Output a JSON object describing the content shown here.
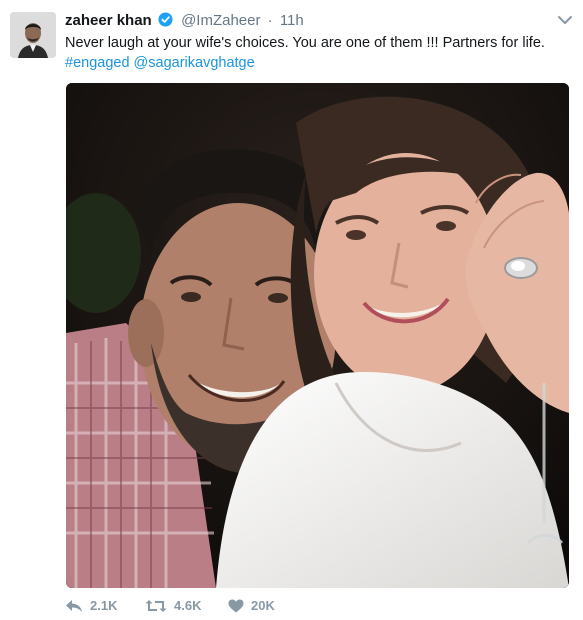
{
  "tweet": {
    "name": "zaheer khan",
    "handle": "@ImZaheer",
    "separator": "·",
    "time": "11h",
    "text": "Never laugh at your wife's choices. You are one of them !!!  Partners for life.",
    "hashtag": "#engaged",
    "mention": "@sagarikavghatge"
  },
  "actions": {
    "replies": "2.1K",
    "retweets": "4.6K",
    "likes": "20K"
  },
  "colors": {
    "link": "#1b95e0",
    "verified": "#1da1f2",
    "muted": "#657786",
    "action": "#8899a6"
  },
  "icons": [
    "verified-badge-icon",
    "chevron-down-icon",
    "reply-icon",
    "retweet-icon",
    "like-icon"
  ]
}
